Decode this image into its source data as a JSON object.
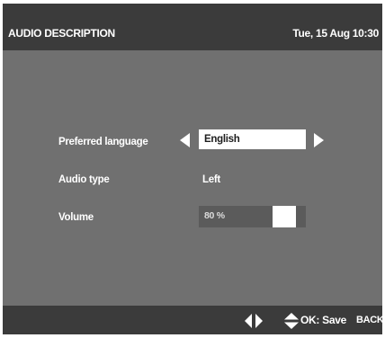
{
  "header": {
    "title": "AUDIO DESCRIPTION",
    "clock": "Tue, 15 Aug 10:30"
  },
  "settings": {
    "preferred_language": {
      "label": "Preferred language",
      "value": "English"
    },
    "audio_type": {
      "label": "Audio type",
      "value": "Left"
    },
    "volume": {
      "label": "Volume",
      "value_text": "80 %",
      "level_percent": 80
    }
  },
  "footer": {
    "navigate_icon": "left-right-arrows-icon",
    "select_icon": "up-down-arrows-icon",
    "ok_label": "OK: Save",
    "back_label": "BACK"
  }
}
